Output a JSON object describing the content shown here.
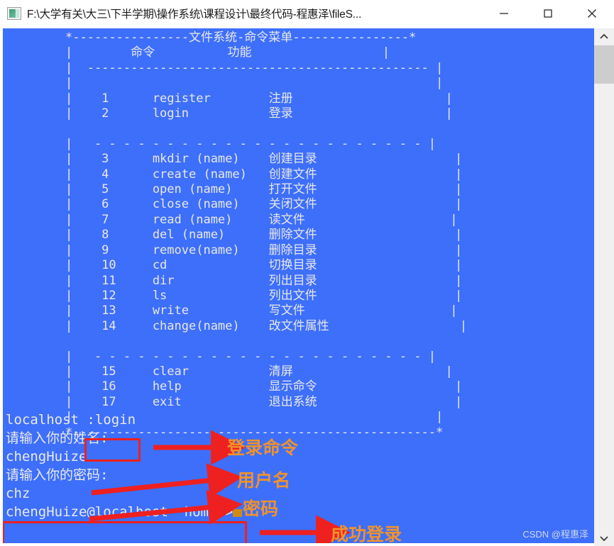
{
  "window": {
    "title": "F:\\大学有关\\大三\\下半学期\\操作系统\\课程设计\\最终代码-程惠泽\\fileS...",
    "icon": "console-window-icon",
    "minimize_label": "—",
    "maximize_label": "☐",
    "close_label": "✕",
    "background_color": "#3d6ffb",
    "text_color": "#e8e8e8"
  },
  "menu": {
    "top_border": "*-----------------文件系统-命令菜单------------------*",
    "header": "|            命令              功能                  |",
    "header_rule": "|  ------------------------------------------------|",
    "dash_rule": "|  -  -  -  -  -  -  -  -  -  -  -  -  -  -  -  -  -|",
    "bottom_border": "*--------------------------------------------------*",
    "col_command": "命令",
    "col_function": "功能",
    "groups": [
      {
        "rows": [
          {
            "no": "1",
            "cmd": "register",
            "desc": "注册"
          },
          {
            "no": "2",
            "cmd": "login",
            "desc": "登录"
          }
        ]
      },
      {
        "rows": [
          {
            "no": "3",
            "cmd": "mkdir (name)",
            "desc": "创建目录"
          },
          {
            "no": "4",
            "cmd": "create (name)",
            "desc": "创建文件"
          },
          {
            "no": "5",
            "cmd": "open (name)",
            "desc": "打开文件"
          },
          {
            "no": "6",
            "cmd": "close (name)",
            "desc": "关闭文件"
          },
          {
            "no": "7",
            "cmd": "read (name)",
            "desc": "读文件"
          },
          {
            "no": "8",
            "cmd": "del (name)",
            "desc": "删除文件"
          },
          {
            "no": "9",
            "cmd": "remove(name)",
            "desc": "删除目录"
          },
          {
            "no": "10",
            "cmd": "cd",
            "desc": "切换目录"
          },
          {
            "no": "11",
            "cmd": "dir",
            "desc": "列出目录"
          },
          {
            "no": "12",
            "cmd": "ls",
            "desc": "列出文件"
          },
          {
            "no": "13",
            "cmd": "write",
            "desc": "写文件"
          },
          {
            "no": "14",
            "cmd": "change(name)",
            "desc": "改文件属性"
          }
        ]
      },
      {
        "rows": [
          {
            "no": "15",
            "cmd": "clear",
            "desc": "清屏"
          },
          {
            "no": "16",
            "cmd": "help",
            "desc": "显示命令"
          },
          {
            "no": "17",
            "cmd": "exit",
            "desc": "退出系统"
          }
        ]
      }
    ]
  },
  "session": {
    "lines": [
      "localhost :login",
      "请输入你的姓名:",
      "chengHuize",
      "请输入你的密码:",
      "chz"
    ],
    "prompt": "chengHuize@localhost  home/>"
  },
  "annotations": {
    "color": "#f0922c",
    "box_color": "#ef2020",
    "items": [
      {
        "label": "登录命令"
      },
      {
        "label": "用户名"
      },
      {
        "label": "密码"
      },
      {
        "label": "成功登录"
      }
    ]
  },
  "watermark": "CSDN @程惠泽",
  "scrollbar": {
    "up_arrow": "∧",
    "down_arrow": "∨"
  }
}
